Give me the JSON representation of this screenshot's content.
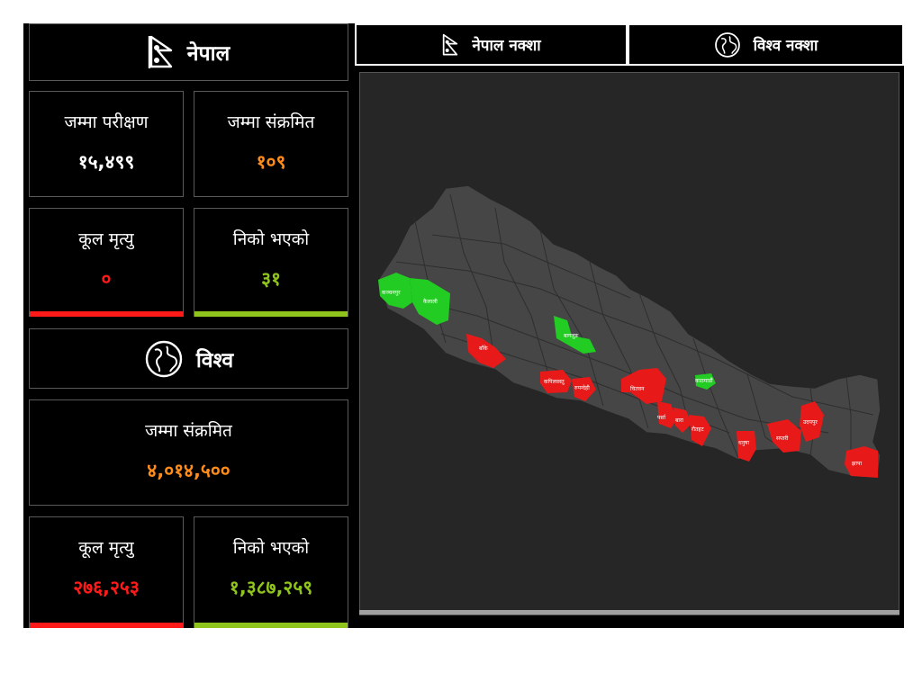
{
  "nepal": {
    "title": "नेपाल",
    "tests_label": "जम्मा परीक्षण",
    "tests_value": "१५,४९९",
    "infected_label": "जम्मा संक्रमित",
    "infected_value": "१०९",
    "deaths_label": "कूल मृत्यु",
    "deaths_value": "०",
    "recovered_label": "निको भएको",
    "recovered_value": "३१"
  },
  "world": {
    "title": "विश्व",
    "infected_label": "जम्मा संक्रमित",
    "infected_value": "४,०१४,५००",
    "deaths_label": "कूल मृत्यु",
    "deaths_value": "२७६,२५३",
    "recovered_label": "निको भएको",
    "recovered_value": "१,३८७,२५९"
  },
  "tabs": [
    {
      "label": "नेपाल नक्शा",
      "icon": "nepal-flag-icon"
    },
    {
      "label": "विश्व नक्शा",
      "icon": "globe-icon"
    }
  ],
  "map": {
    "district_labels": [
      "कञ्चनपुर",
      "कैलाली",
      "बाँके",
      "बागलुङ",
      "कपिलवस्तु",
      "रुपन्देही",
      "चितवन",
      "पर्सा",
      "बारा",
      "रौतहट",
      "काठमाडौं",
      "धनुषा",
      "सप्तरी",
      "उदयपुर",
      "झापा"
    ]
  },
  "colors": {
    "infected_accent": "#ff8c1a",
    "deaths_accent": "#ff1a1a",
    "recovered_accent": "#8fc41c",
    "infected_district": "#e81919",
    "recovered_district": "#22cc22",
    "district_default": "#464646"
  }
}
